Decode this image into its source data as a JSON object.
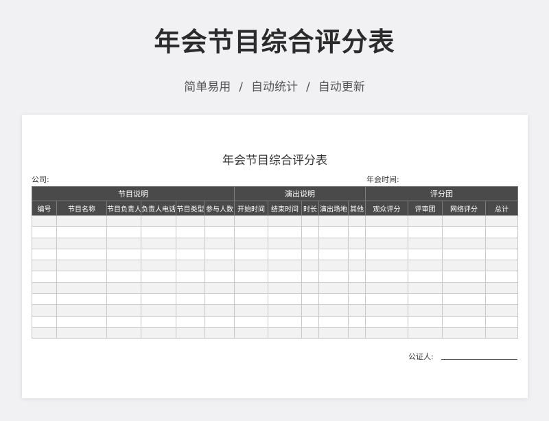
{
  "banner": {
    "title": "年会节目综合评分表",
    "subtitle_items": [
      "简单易用",
      "自动统计",
      "自动更新"
    ],
    "separator": "/"
  },
  "sheet": {
    "title": "年会节目综合评分表",
    "company_label": "公司:",
    "meeting_time_label": "年会时间:",
    "groups": [
      "节目说明",
      "演出说明",
      "评分团"
    ],
    "columns": [
      "编号",
      "节目名称",
      "节目负责人",
      "负责人电话",
      "节目类型",
      "参与人数",
      "开始时间",
      "结束时间",
      "时长",
      "演出场地",
      "其他",
      "观众评分",
      "评审团",
      "网络评分",
      "总计"
    ],
    "empty_rows": 11,
    "notary_label": "公证人:"
  },
  "colors": {
    "header_bg": "#4a4a4a",
    "header_text": "#ffffff",
    "stripe": "#f2f2f2",
    "page_bg": "#f1f1f3"
  }
}
